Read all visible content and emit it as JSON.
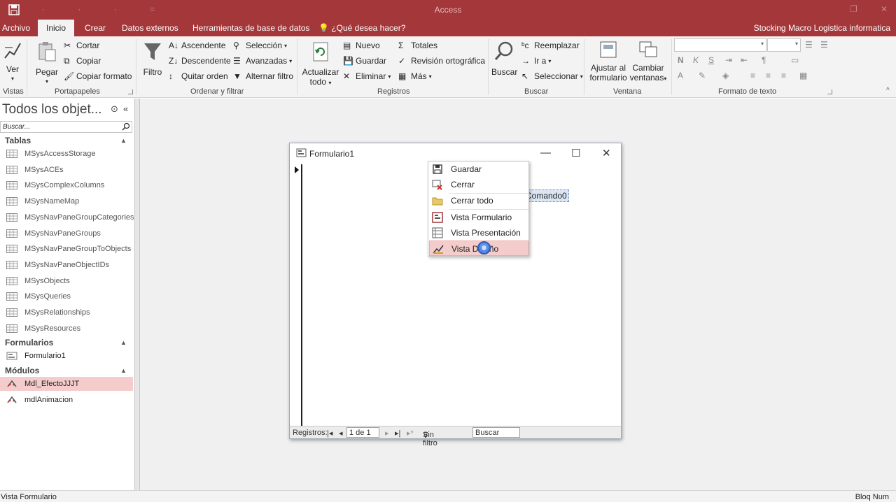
{
  "window": {
    "title": "Access",
    "accent": "#a4373a"
  },
  "tabs": {
    "archivo": "Archivo",
    "inicio": "Inicio",
    "crear": "Crear",
    "datos_externos": "Datos externos",
    "herramientas": "Herramientas de base de datos",
    "tell_me": "¿Qué desea hacer?",
    "account": "Stocking Macro Logistica informatica"
  },
  "ribbon": {
    "vistas": {
      "ver": "Ver",
      "label": "Vistas"
    },
    "portapapeles": {
      "pegar": "Pegar",
      "cortar": "Cortar",
      "copiar": "Copiar",
      "copiar_formato": "Copiar formato",
      "label": "Portapapeles"
    },
    "ordenar": {
      "filtro": "Filtro",
      "ascendente": "Ascendente",
      "descendente": "Descendente",
      "quitar_orden": "Quitar orden",
      "seleccion": "Selección",
      "avanzadas": "Avanzadas",
      "alternar": "Alternar filtro",
      "label": "Ordenar y filtrar"
    },
    "registros": {
      "actualizar1": "Actualizar",
      "actualizar2": "todo",
      "nuevo": "Nuevo",
      "guardar": "Guardar",
      "eliminar": "Eliminar",
      "totales": "Totales",
      "revision": "Revisión ortográfica",
      "mas": "Más",
      "label": "Registros"
    },
    "buscar": {
      "buscar": "Buscar",
      "reemplazar": "Reemplazar",
      "ir_a": "Ir a",
      "seleccionar": "Seleccionar",
      "label": "Buscar"
    },
    "ventana": {
      "ajustar1": "Ajustar al",
      "ajustar2": "formulario",
      "cambiar1": "Cambiar",
      "cambiar2": "ventanas",
      "label": "Ventana"
    },
    "formato": {
      "bold": "N",
      "italic": "K",
      "underline": "S",
      "label": "Formato de texto"
    }
  },
  "navpane": {
    "title": "Todos los objet...",
    "search_placeholder": "Buscar...",
    "sections": {
      "tablas": "Tablas",
      "formularios": "Formularios",
      "modulos": "Módulos"
    },
    "tables": [
      "MSysAccessStorage",
      "MSysACEs",
      "MSysComplexColumns",
      "MSysNameMap",
      "MSysNavPaneGroupCategories",
      "MSysNavPaneGroups",
      "MSysNavPaneGroupToObjects",
      "MSysNavPaneObjectIDs",
      "MSysObjects",
      "MSysQueries",
      "MSysRelationships",
      "MSysResources"
    ],
    "forms": [
      "Formulario1"
    ],
    "modules": [
      "Mdl_EfectoJJJT",
      "mdlAnimacion"
    ]
  },
  "form": {
    "title": "Formulario1",
    "command_button": "Comando0",
    "recnav": {
      "label": "Registros:",
      "position": "1 de 1",
      "filter": "Sin filtro",
      "search": "Buscar"
    }
  },
  "context_menu": {
    "items": [
      "Guardar",
      "Cerrar",
      "Cerrar todo",
      "Vista Formulario",
      "Vista Presentación",
      "Vista Diseño"
    ]
  },
  "status": {
    "left": "Vista Formulario",
    "right": "Bloq Num"
  }
}
